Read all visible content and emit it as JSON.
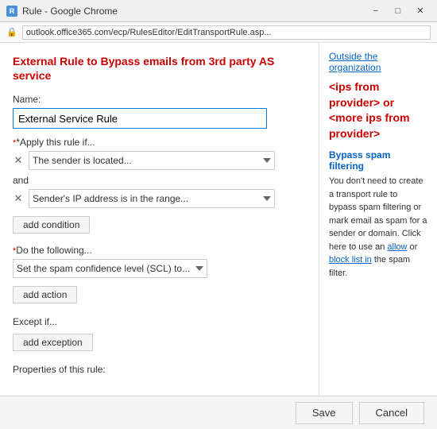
{
  "titleBar": {
    "icon": "R",
    "title": "Rule - Google Chrome",
    "minimize": "−",
    "maximize": "□",
    "close": "✕"
  },
  "addressBar": {
    "lock": "🔒",
    "url": "outlook.office365.com/ecp/RulesEditor/EditTransportRule.asp..."
  },
  "page": {
    "title": "External Rule to Bypass emails from 3rd party AS service",
    "nameLabel": "Name:",
    "nameValue": "External Service Rule",
    "applyIfLabel": "*Apply this rule if...",
    "condition1": "The sender is located...",
    "andLabel": "and",
    "condition2": "Sender's IP address is in the range...",
    "addConditionLabel": "add condition",
    "doFollowingLabel": "*Do the following...",
    "action1": "Set the spam confidence level (SCL) to...",
    "addActionLabel": "add action",
    "exceptIfLabel": "Except if...",
    "addExceptionLabel": "add exception",
    "propertiesLabel": "Properties of this rule:",
    "saveLabel": "Save",
    "cancelLabel": "Cancel"
  },
  "sidePanel": {
    "outsideOrgLink": "Outside the organization",
    "ipsText": "<ips from provider> or <more ips from provider>",
    "bypassTitle": "Bypass spam filtering",
    "bypassText": "You don't need to create a transport rule to bypass spam filtering or mark email as spam for a sender or domain. Click here to use an ",
    "allowLink": "allow",
    "orText": " or ",
    "blockLink": "block list in",
    "spamText": " the spam filter."
  }
}
